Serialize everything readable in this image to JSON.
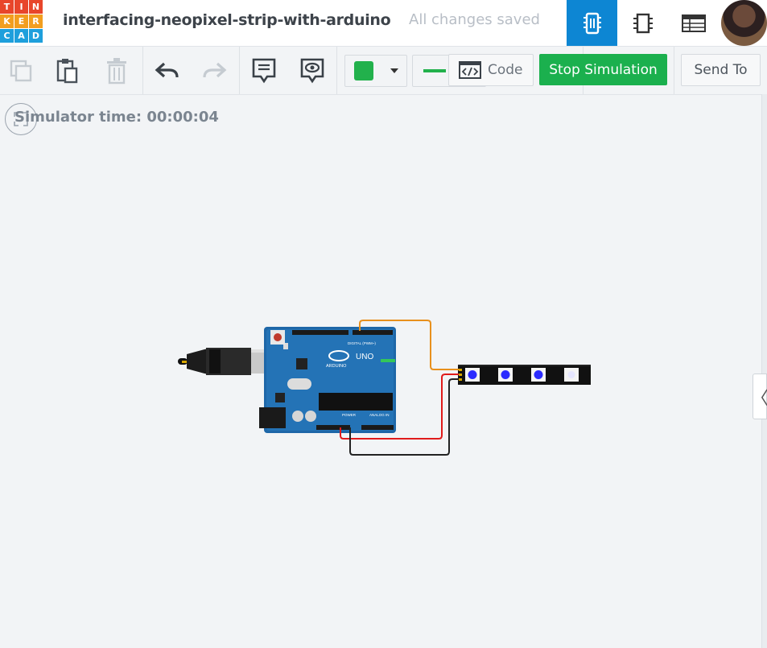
{
  "header": {
    "logo_letters": [
      "T",
      "I",
      "N",
      "K",
      "E",
      "R",
      "C",
      "A",
      "D"
    ],
    "logo_colors": [
      "#e8462b",
      "#e8462b",
      "#e8462b",
      "#f29e1f",
      "#f29e1f",
      "#f29e1f",
      "#1e9fdc",
      "#1e9fdc",
      "#1e9fdc"
    ],
    "project_title": "interfacing-neopixel-strip-with-arduino",
    "save_status": "All changes saved",
    "views": [
      {
        "icon": "circuit-view-icon",
        "active": true
      },
      {
        "icon": "schematic-view-icon",
        "active": false
      },
      {
        "icon": "component-list-icon",
        "active": false
      }
    ]
  },
  "toolbar": {
    "tools": [
      "copy-icon",
      "paste-icon",
      "delete-icon",
      "undo-icon",
      "redo-icon",
      "notes-icon",
      "visibility-icon"
    ],
    "wire_color": "#22b14c",
    "code_label": "Code",
    "stop_label": "Stop Simulation",
    "send_label": "Send To"
  },
  "canvas": {
    "sim_time": "Simulator time: 00:00:04",
    "board_labels": {
      "brand": "ARDUINO",
      "model": "UNO",
      "digital": "DIGITAL (PWM~)",
      "power": "POWER",
      "analog": "ANALOG IN"
    },
    "strip_pixel_colors": [
      "#2b2bff",
      "#2b2bff",
      "#2b2bff",
      "#e6e6ff"
    ],
    "wire_colors": {
      "data": "#e8901c",
      "power": "#e01b1b",
      "ground": "#222222"
    }
  }
}
